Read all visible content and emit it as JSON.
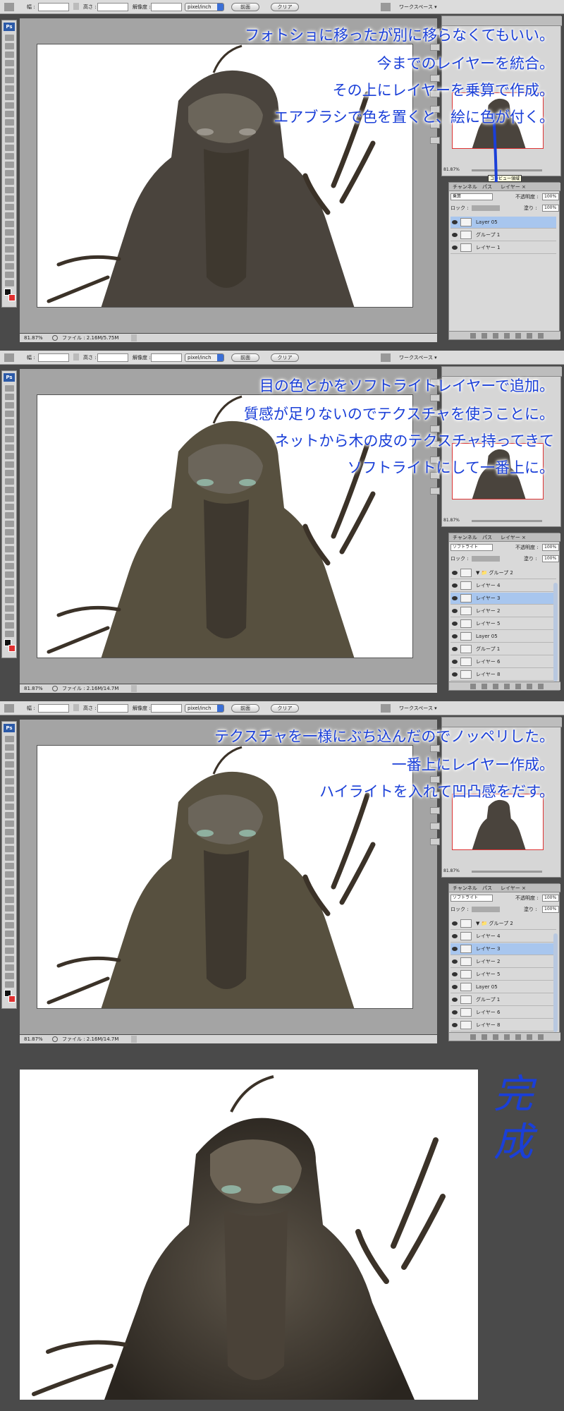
{
  "toolbar": {
    "width_label": "幅 :",
    "height_label": "高さ :",
    "resolution_label": "解像度 :",
    "unit_select": "pixel/inch",
    "front_button": "前面",
    "clear_button": "クリア",
    "workspace_menu": "ワークスペース ▾"
  },
  "ps_logo": "Ps",
  "panels": [
    {
      "zoom": "81.87%",
      "file_info": "ファイル : 2.16M/5.75M",
      "captions": [
        "フォトショに移ったが別に移らなくてもいい。",
        "今までのレイヤーを統合。",
        "その上にレイヤーを乗算で作成。",
        "エアブラシで色を置くと、絵に色が付く。"
      ],
      "tooltip": "コンビュー領域",
      "layer_tabs": [
        "チャンネル",
        "パス",
        "レイヤー ×"
      ],
      "blend_mode": "乗算",
      "opacity_label": "不透明度 :",
      "opacity_value": "100%",
      "lock_label": "ロック :",
      "fill_label": "塗り :",
      "fill_value": "100%",
      "layers": [
        {
          "name": "Layer 05",
          "selected": true
        },
        {
          "name": "グループ 1",
          "selected": false
        },
        {
          "name": "レイヤー 1",
          "selected": false
        }
      ]
    },
    {
      "zoom": "81.87%",
      "file_info": "ファイル : 2.16M/14.7M",
      "captions": [
        "目の色とかをソフトライトレイヤーで追加。",
        "質感が足りないのでテクスチャを使うことに。",
        "ネットから木の皮のテクスチャ持ってきて",
        "ソフトライトにして一番上に。"
      ],
      "layer_tabs": [
        "チャンネル",
        "パス",
        "レイヤー ×"
      ],
      "blend_mode": "ソフトライト",
      "opacity_label": "不透明度 :",
      "opacity_value": "100%",
      "lock_label": "ロック :",
      "fill_label": "塗り :",
      "fill_value": "100%",
      "layers": [
        {
          "name": "▼ 📁 グループ 2",
          "selected": false
        },
        {
          "name": "レイヤー 4",
          "selected": false
        },
        {
          "name": "レイヤー 3",
          "selected": true
        },
        {
          "name": "レイヤー 2",
          "selected": false
        },
        {
          "name": "レイヤー 5",
          "selected": false
        },
        {
          "name": "Layer 05",
          "selected": false
        },
        {
          "name": "グループ 1",
          "selected": false
        },
        {
          "name": "レイヤー 6",
          "selected": false
        },
        {
          "name": "レイヤー 8",
          "selected": false
        }
      ]
    },
    {
      "zoom": "81.87%",
      "file_info": "ファイル : 2.16M/14.7M",
      "captions": [
        "テクスチャを一様にぶち込んだのでノッペリした。",
        "一番上にレイヤー作成。",
        "ハイライトを入れて凹凸感をだす。"
      ],
      "layer_tabs": [
        "チャンネル",
        "パス",
        "レイヤー ×"
      ],
      "blend_mode": "ソフトライト",
      "opacity_label": "不透明度 :",
      "opacity_value": "100%",
      "lock_label": "ロック :",
      "fill_label": "塗り :",
      "fill_value": "100%",
      "layers": [
        {
          "name": "▼ 📁 グループ 2",
          "selected": false
        },
        {
          "name": "レイヤー 4",
          "selected": false
        },
        {
          "name": "レイヤー 3",
          "selected": true
        },
        {
          "name": "レイヤー 2",
          "selected": false
        },
        {
          "name": "レイヤー 5",
          "selected": false
        },
        {
          "name": "Layer 05",
          "selected": false
        },
        {
          "name": "グループ 1",
          "selected": false
        },
        {
          "name": "レイヤー 6",
          "selected": false
        },
        {
          "name": "レイヤー 8",
          "selected": false
        }
      ]
    }
  ],
  "final_label": "完成",
  "colors": {
    "caption": "#1a3fd8",
    "selection": "#a8c6ee",
    "ps_blue": "#2c5aa8",
    "background_swatch": "#e03030"
  }
}
